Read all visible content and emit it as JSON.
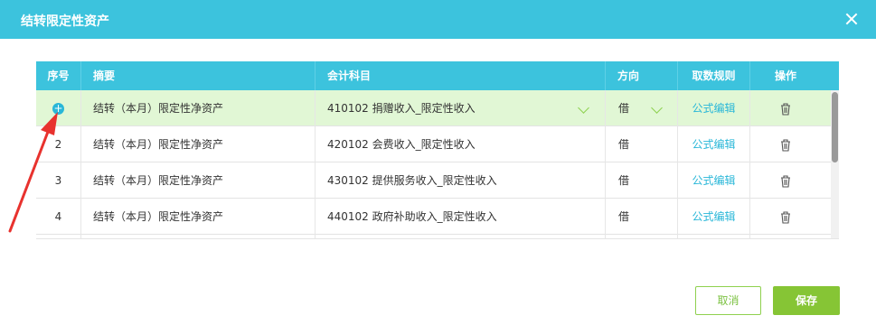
{
  "dialog": {
    "title": "结转限定性资产"
  },
  "table": {
    "headers": [
      "序号",
      "摘要",
      "会计科目",
      "方向",
      "取数规则",
      "操作"
    ],
    "rows": [
      {
        "index": "+",
        "summary": "结转（本月）限定性净资产",
        "account": "410102  捐赠收入_限定性收入",
        "direction": "借",
        "rule": "公式编辑"
      },
      {
        "index": "2",
        "summary": "结转（本月）限定性净资产",
        "account": "420102  会费收入_限定性收入",
        "direction": "借",
        "rule": "公式编辑"
      },
      {
        "index": "3",
        "summary": "结转（本月）限定性净资产",
        "account": "430102  提供服务收入_限定性收入",
        "direction": "借",
        "rule": "公式编辑"
      },
      {
        "index": "4",
        "summary": "结转（本月）限定性净资产",
        "account": "440102  政府补助收入_限定性收入",
        "direction": "借",
        "rule": "公式编辑"
      }
    ]
  },
  "buttons": {
    "cancel": "取消",
    "save": "保存"
  },
  "colors": {
    "header": "#3cc3dd",
    "selected_row": "#e1f7d5",
    "save": "#86c535",
    "link": "#29b7d8",
    "annotation_arrow": "#e8322e"
  },
  "icons": {
    "close": "close-icon",
    "add": "plus-circle-icon",
    "delete": "trash-icon",
    "dropdown": "chevron-down-icon"
  }
}
